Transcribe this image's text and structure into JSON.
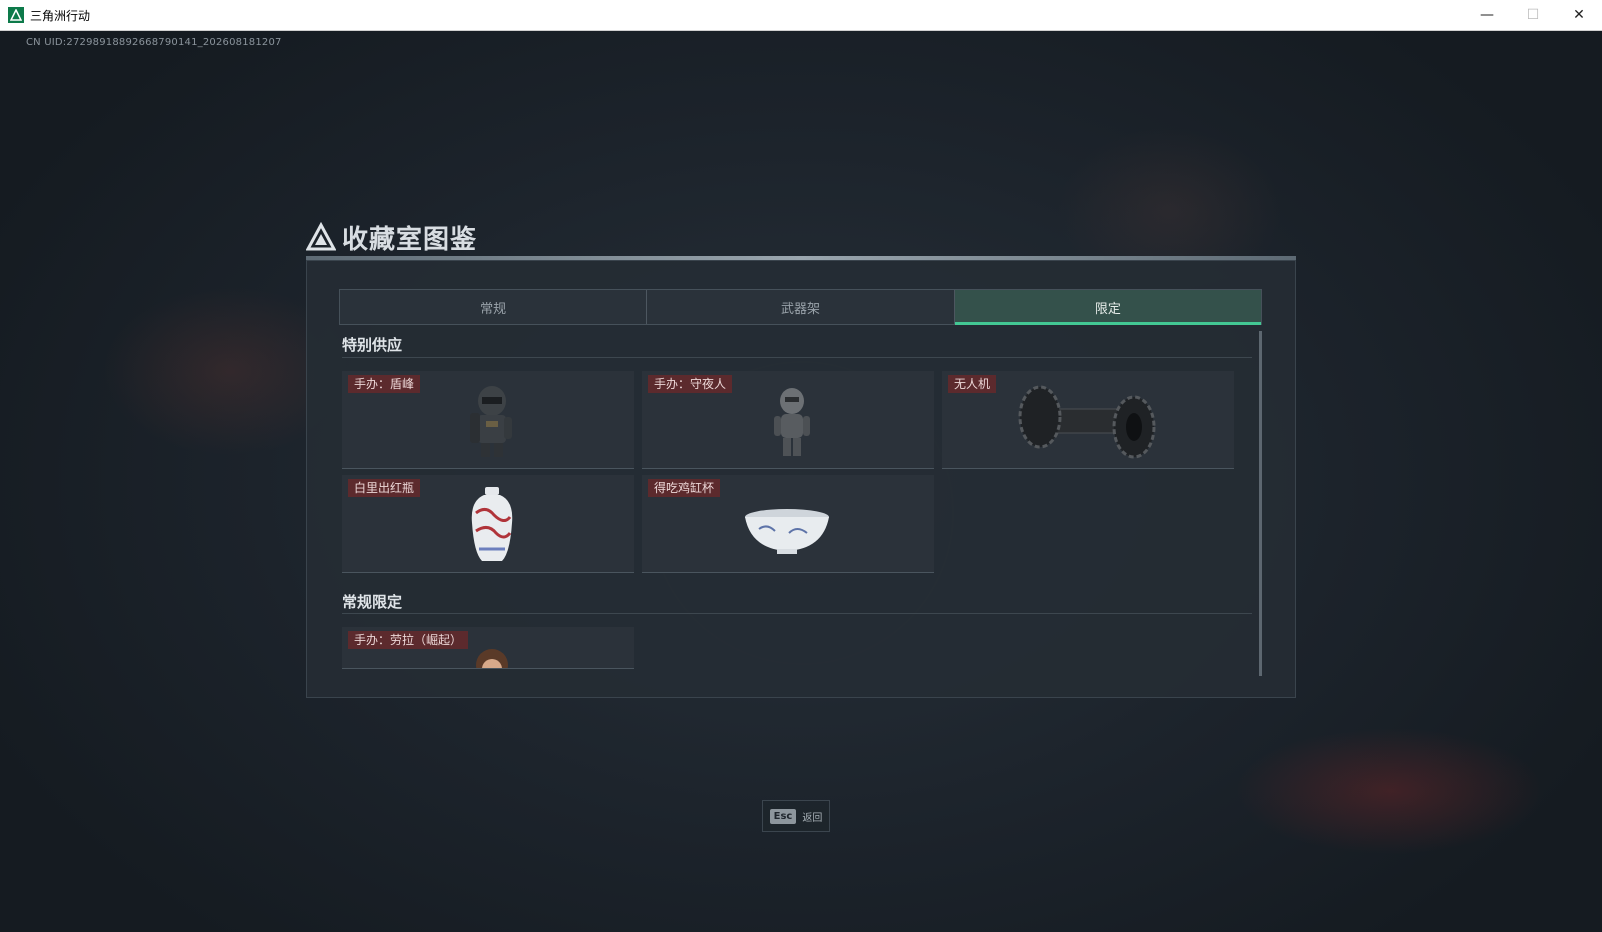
{
  "window": {
    "title": "三角洲行动",
    "controls": {
      "minimize": "—",
      "maximize": "☐",
      "close": "✕"
    }
  },
  "uid": "CN UID:27298918892668790141_202608181207",
  "panel": {
    "title": "收藏室图鉴",
    "tabs": [
      {
        "label": "常规",
        "active": false
      },
      {
        "label": "武器架",
        "active": false
      },
      {
        "label": "限定",
        "active": true
      }
    ],
    "sections": [
      {
        "title": "特别供应",
        "items": [
          {
            "label": "手办：盾峰",
            "icon": "figurine-armored-icon"
          },
          {
            "label": "手办：守夜人",
            "icon": "figurine-robot-icon"
          },
          {
            "label": "无人机",
            "icon": "drone-roller-icon"
          },
          {
            "label": "白里出红瓶",
            "icon": "porcelain-vase-icon"
          },
          {
            "label": "得吃鸡缸杯",
            "icon": "porcelain-bowl-icon"
          }
        ]
      },
      {
        "title": "常规限定",
        "items": [
          {
            "label": "手办：劳拉（崛起）",
            "icon": "figurine-lara-icon"
          }
        ]
      }
    ]
  },
  "footer": {
    "esc_key": "Esc",
    "esc_label": "返回"
  },
  "colors": {
    "accent": "#43c894",
    "label_bg": "#5c2a2d",
    "active_tab": "#34514b"
  }
}
